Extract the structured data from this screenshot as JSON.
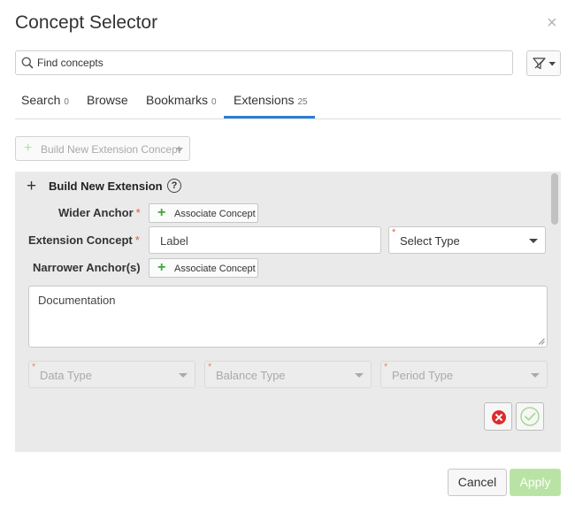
{
  "dialog": {
    "title": "Concept Selector",
    "close_symbol": "×"
  },
  "search": {
    "placeholder": "Find concepts",
    "value": ""
  },
  "tabs": [
    {
      "label": "Search",
      "count": "0"
    },
    {
      "label": "Browse",
      "count": ""
    },
    {
      "label": "Bookmarks",
      "count": "0"
    },
    {
      "label": "Extensions",
      "count": "25",
      "active": true
    }
  ],
  "toolbar": {
    "build_button_label": "Build New Extension Concept"
  },
  "panel": {
    "title": "Build New Extension",
    "help_symbol": "?",
    "wider_anchor_label": "Wider Anchor",
    "extension_concept_label": "Extension Concept",
    "narrower_anchor_label": "Narrower Anchor(s)",
    "required_mark": "*",
    "associate_button_label": "Associate Concept",
    "label_placeholder": "Label",
    "select_type_value": "Select Type",
    "documentation_placeholder": "Documentation",
    "data_type_value": "Data Type",
    "balance_type_value": "Balance Type",
    "period_type_value": "Period Type"
  },
  "footer": {
    "cancel_label": "Cancel",
    "apply_label": "Apply"
  },
  "colors": {
    "accent": "#2b80d5",
    "required": "#e55d3a",
    "add_green": "#3aa83a",
    "apply_disabled": "#b8e3a4",
    "cancel_red": "#dd2c2c"
  },
  "icons": {
    "search": "magnifier-icon",
    "filter": "filter-icon",
    "close": "close-icon",
    "help": "question-circle-icon",
    "cancel": "cancel-circle-icon",
    "confirm": "check-circle-icon"
  }
}
